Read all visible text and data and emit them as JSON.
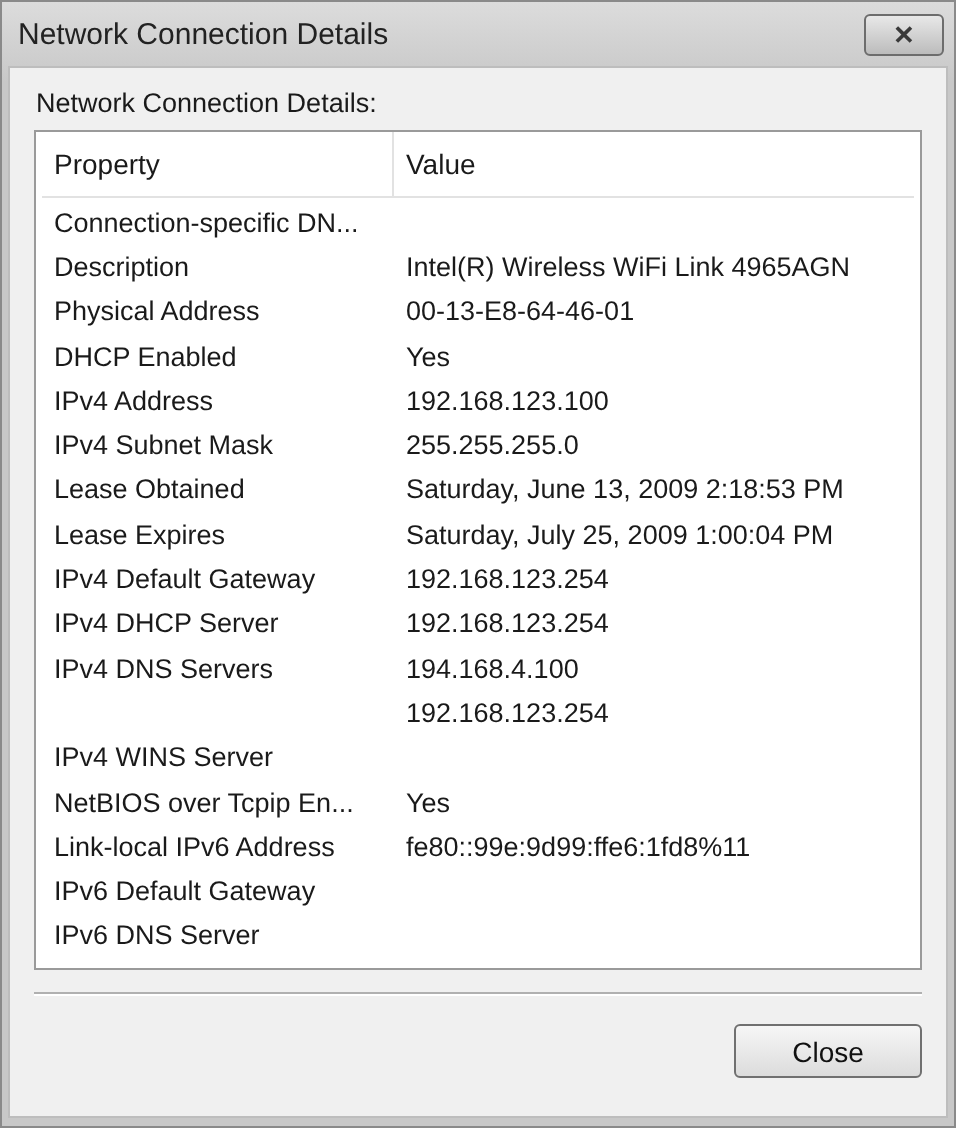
{
  "window": {
    "title": "Network Connection Details",
    "close_glyph": "✕"
  },
  "group_label": "Network Connection Details:",
  "table": {
    "columns": [
      "Property",
      "Value"
    ],
    "rows": [
      {
        "property": "Connection-specific DN..."
      },
      {
        "property": "Description",
        "value": "Intel(R) Wireless WiFi Link 4965AGN"
      },
      {
        "property": "Physical Address",
        "value": "00-13-E8-64-46-01"
      },
      {
        "property": "DHCP Enabled",
        "value": "Yes"
      },
      {
        "property": "IPv4 Address",
        "value": "192.168.123.100"
      },
      {
        "property": "IPv4 Subnet Mask",
        "value": "255.255.255.0"
      },
      {
        "property": "Lease Obtained",
        "value": "Saturday, June 13, 2009 2:18:53 PM"
      },
      {
        "property": "Lease Expires",
        "value": "Saturday, July 25, 2009 1:00:04 PM"
      },
      {
        "property": "IPv4 Default Gateway",
        "value": "192.168.123.254"
      },
      {
        "property": "IPv4 DHCP Server",
        "value": "192.168.123.254"
      },
      {
        "property": "IPv4 DNS Servers",
        "value": "194.168.4.100"
      },
      {
        "value": "192.168.123.254"
      },
      {
        "property": "IPv4 WINS Server"
      },
      {
        "property": "NetBIOS over Tcpip En...",
        "value": "Yes"
      },
      {
        "property": "Link-local IPv6 Address",
        "value": "fe80::99e:9d99:ffe6:1fd8%11"
      },
      {
        "property": "IPv6 Default Gateway"
      },
      {
        "property": "IPv6 DNS Server"
      }
    ]
  },
  "buttons": [
    "Close"
  ]
}
